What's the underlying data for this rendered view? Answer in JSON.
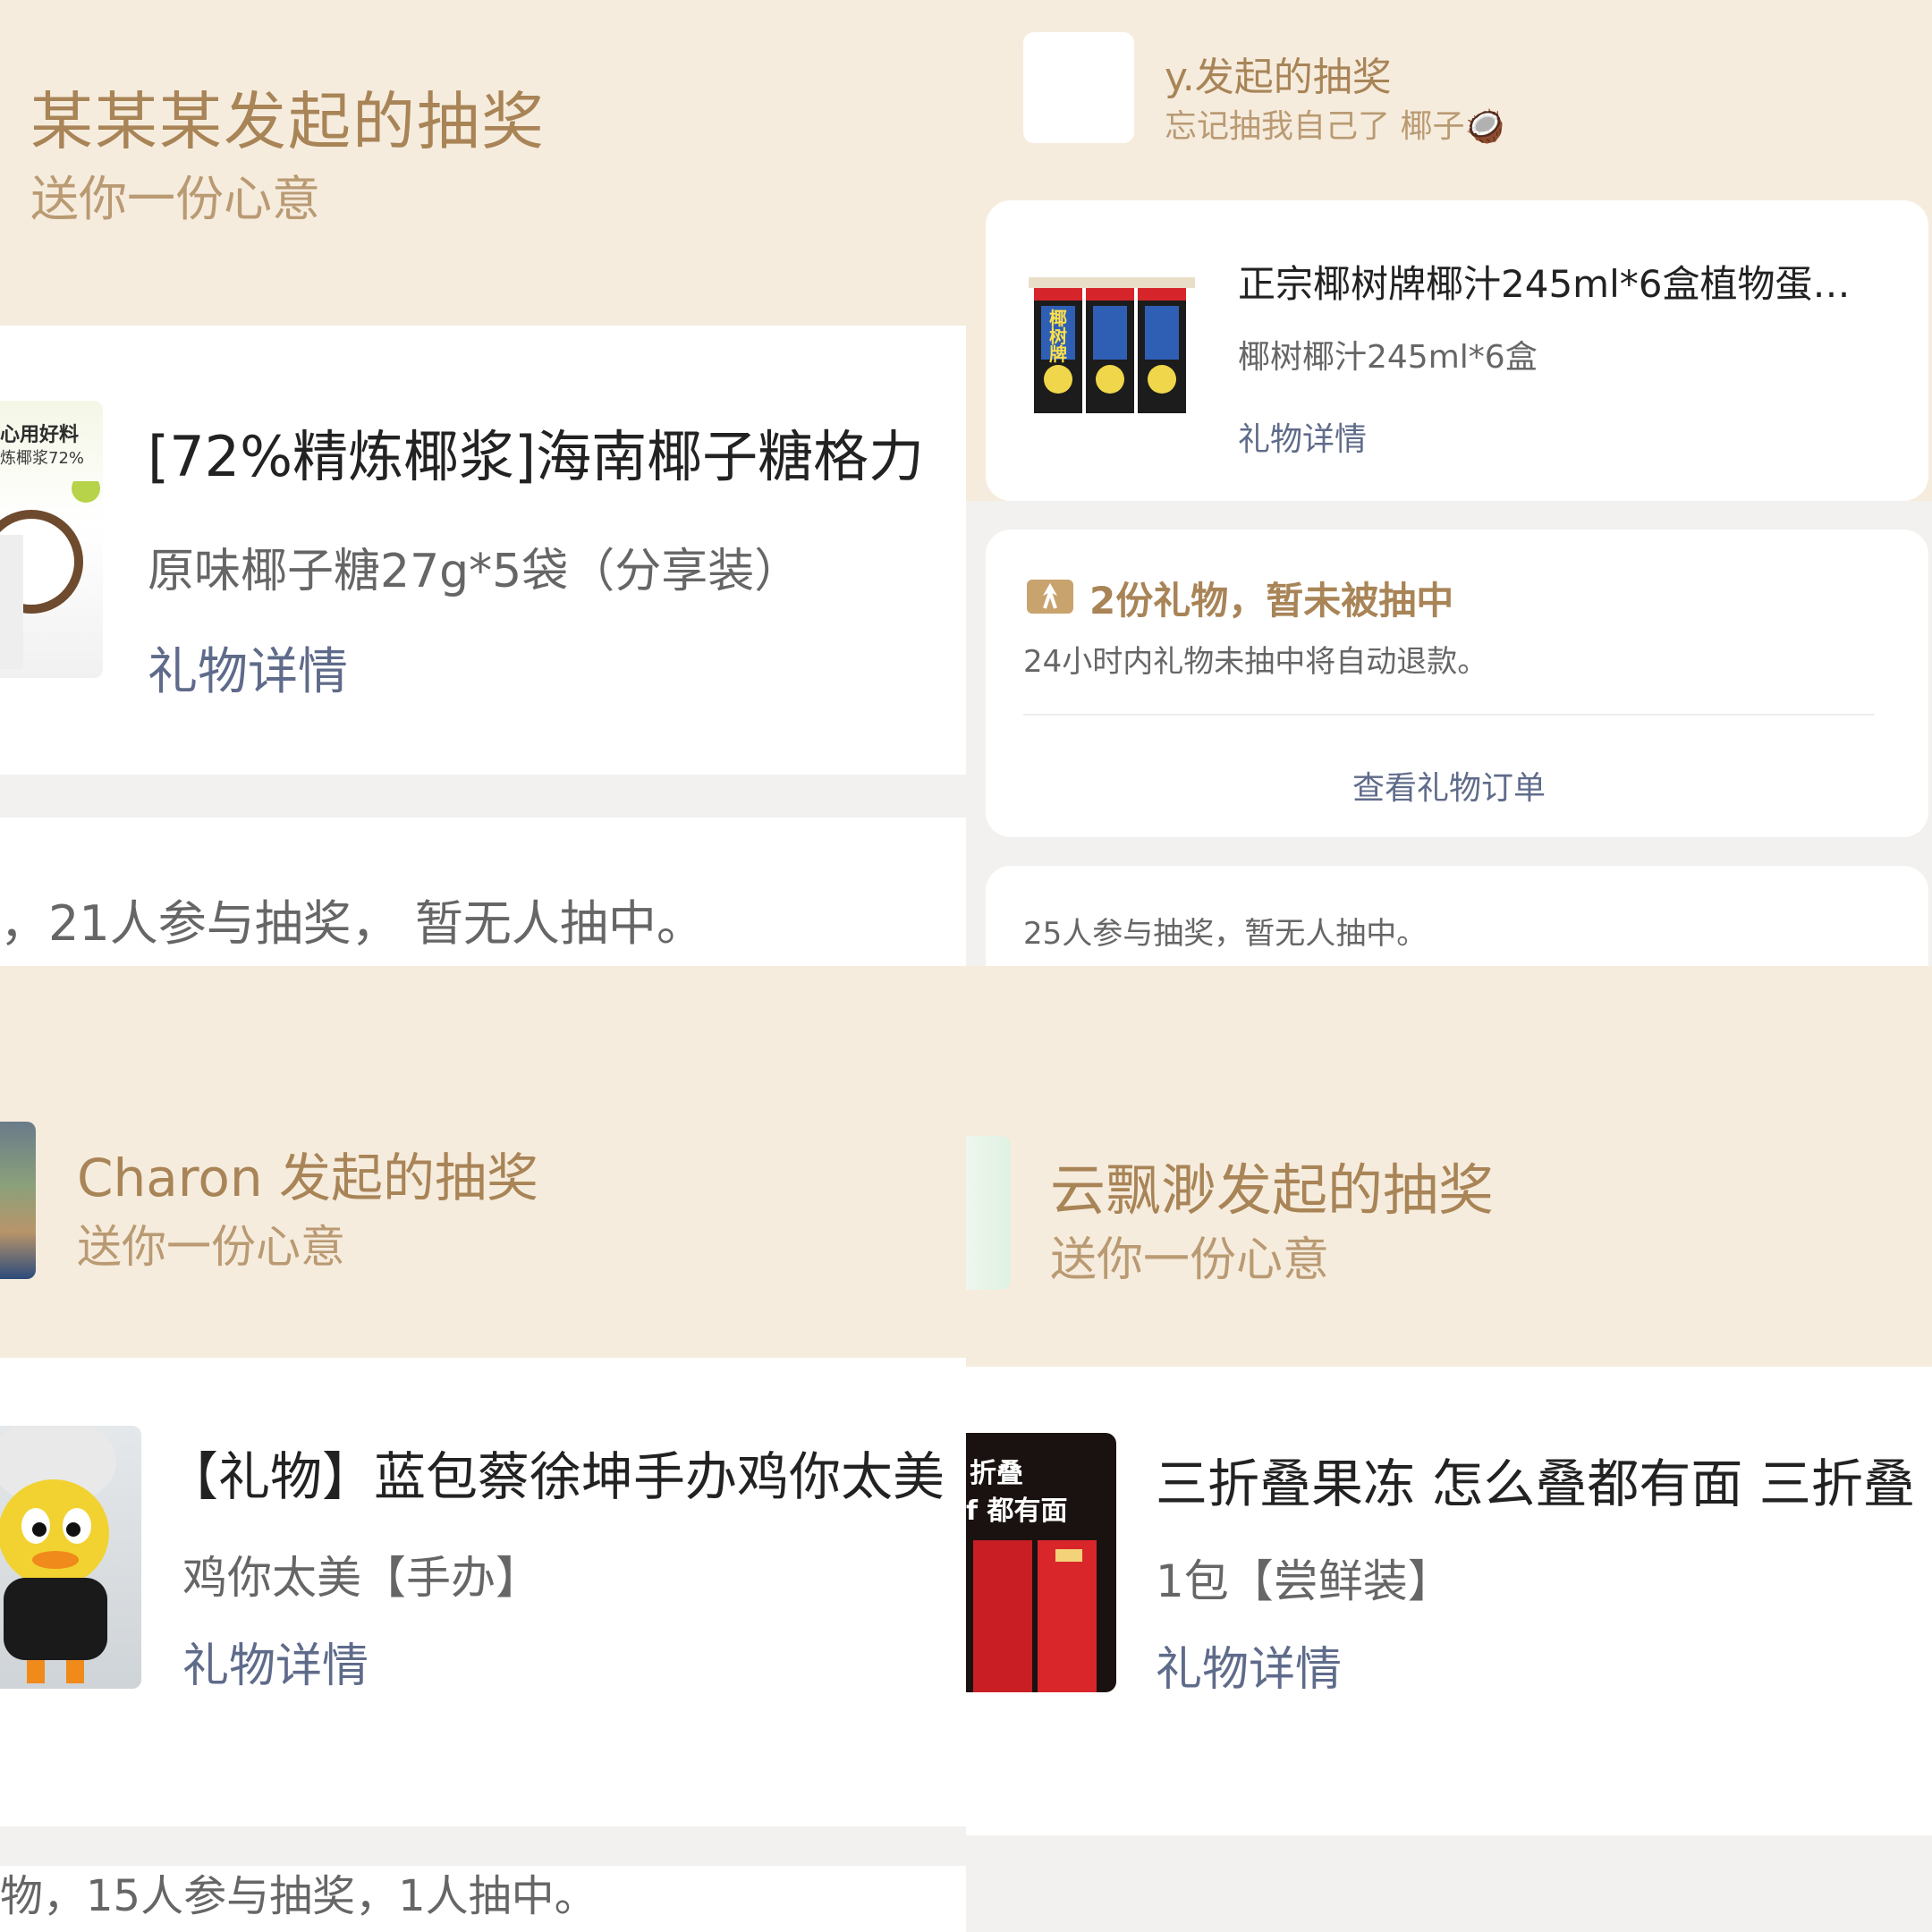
{
  "panel_a": {
    "title": "某某某发起的抽奖",
    "subtitle": "送你一份心意",
    "product_name": "[72%精炼椰浆]海南椰子糖格力",
    "product_spec": "原味椰子糖27g*5袋（分享装）",
    "gift_detail_link": "礼物详情",
    "thumb_text_1": "心用好料",
    "thumb_text_2": "炼椰浆72%",
    "status": "，21人参与抽奖， 暂无人抽中。"
  },
  "panel_b": {
    "title": "y.发起的抽奖",
    "subtitle": "忘记抽我自己了 椰子",
    "subtitle_emoji": "🥥",
    "product_name": "正宗椰树牌椰汁245ml*6盒植物蛋…",
    "product_spec": "椰树椰汁245ml*6盒",
    "gift_detail_link": "礼物详情",
    "carton_label": "椰树牌",
    "gift_count": "2份礼物，暂未被抽中",
    "refund_note": "24小时内礼物未抽中将自动退款。",
    "view_order_link": "查看礼物订单",
    "status": "25人参与抽奖，暂无人抽中。"
  },
  "panel_c": {
    "title": "Charon 发起的抽奖",
    "subtitle": "送你一份心意",
    "product_name": "【礼物】蓝包蔡徐坤手办鸡你太美",
    "product_spec": "鸡你太美【手办】",
    "gift_detail_link": "礼物详情",
    "status": "物，15人参与抽奖，1人抽中。"
  },
  "panel_d": {
    "title": "云飘渺发起的抽奖",
    "subtitle": "送你一份心意",
    "product_name": "三折叠果冻 怎么叠都有面 三折叠",
    "product_spec": "1包【尝鲜装】",
    "gift_detail_link": "礼物详情",
    "thumb_text_1": "折叠",
    "thumb_text_2": "f 都有面"
  },
  "colors": {
    "cream_background": "#f6ecdd",
    "title_brown": "#a88457",
    "link_blue": "#5f6b8a",
    "gap_grey": "#f2f1ef"
  }
}
